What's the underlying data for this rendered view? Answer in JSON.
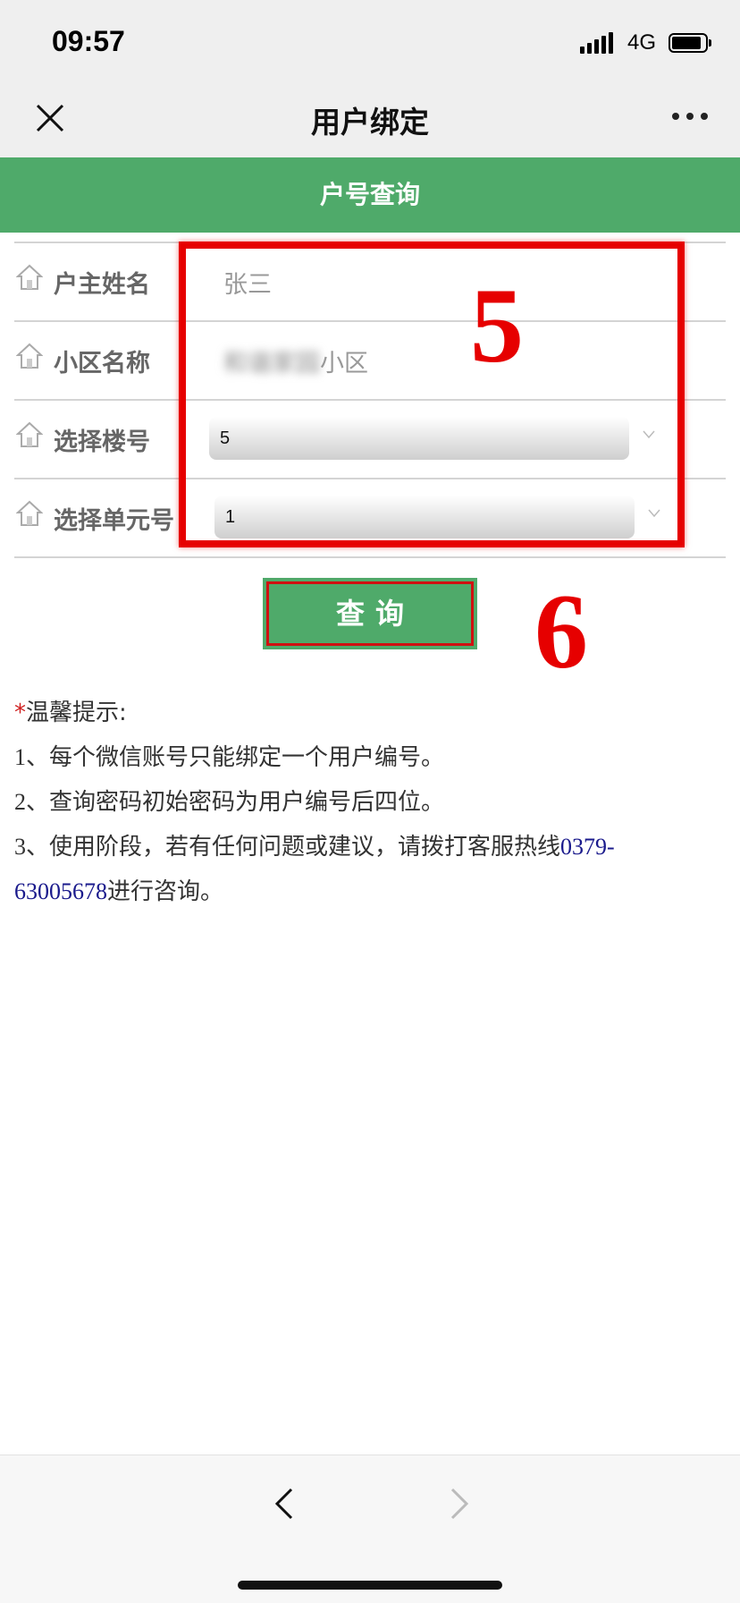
{
  "status_bar": {
    "time": "09:57",
    "network": "4G",
    "icons": [
      "signal-icon",
      "battery-icon"
    ]
  },
  "nav": {
    "title": "用户绑定",
    "icons": [
      "close-icon",
      "more-icon"
    ]
  },
  "section": {
    "title": "户号查询"
  },
  "form": {
    "owner_name": {
      "label": "户主姓名",
      "value": "张三"
    },
    "community": {
      "label": "小区名称",
      "value_blurred": "和谐家园",
      "value_suffix": "小区"
    },
    "building": {
      "label": "选择楼号",
      "selected": "5"
    },
    "unit": {
      "label": "选择单元号",
      "selected": "1"
    },
    "row_icon": "house-icon"
  },
  "annotations": {
    "step_5": "5",
    "step_6": "6",
    "highlight_color": "#e60000"
  },
  "query_button": {
    "label": "查询"
  },
  "tips": {
    "star": "*",
    "title": "温馨提示:",
    "item1_num": "1",
    "item1_text": "、每个微信账号只能绑定一个用户编号。",
    "item2_num": "2",
    "item2_text": "、查询密码初始密码为用户编号后四位。",
    "item3_num": "3",
    "item3_text": "、使用阶段，若有任何问题或建议，请拨打客服热线",
    "hotline_part1": "0379-",
    "hotline_part2": "63005678",
    "item3_tail": "进行咨询。"
  },
  "bottom_bar": {
    "icons": [
      "back-icon",
      "forward-icon"
    ]
  },
  "colors": {
    "accent_green": "#4faa6a",
    "annotation_red": "#e60000",
    "hotline_blue": "#1a1a8c"
  }
}
